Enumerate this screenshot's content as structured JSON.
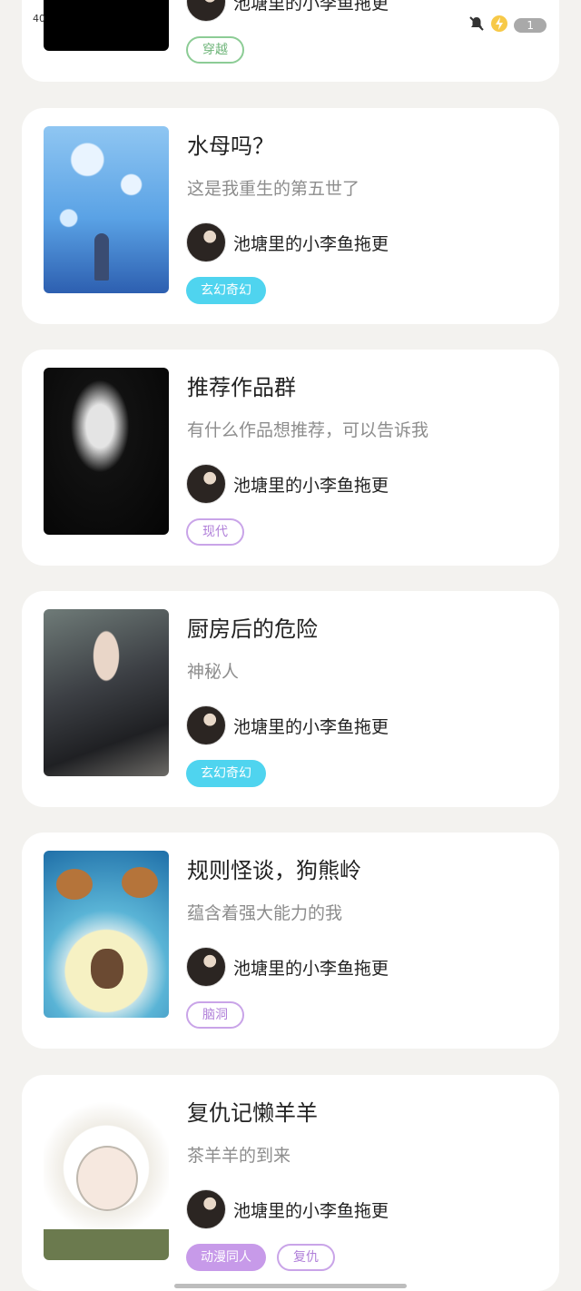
{
  "status": {
    "signal_text": "40",
    "badge_count": "1"
  },
  "works": [
    {
      "title": "",
      "desc": "",
      "author": "池塘里的小李鱼拖更",
      "tags": [
        {
          "label": "穿越"
        }
      ]
    },
    {
      "title": "水母吗？",
      "desc": "这是我重生的第五世了",
      "author": "池塘里的小李鱼拖更",
      "tags": [
        {
          "label": "玄幻奇幻"
        }
      ]
    },
    {
      "title": "推荐作品群",
      "desc": "有什么作品想推荐，可以告诉我",
      "author": "池塘里的小李鱼拖更",
      "tags": [
        {
          "label": "现代"
        }
      ]
    },
    {
      "title": "厨房后的危险",
      "desc": "神秘人",
      "author": "池塘里的小李鱼拖更",
      "tags": [
        {
          "label": "玄幻奇幻"
        }
      ]
    },
    {
      "title": "规则怪谈，狗熊岭",
      "desc": "蕴含着强大能力的我",
      "author": "池塘里的小李鱼拖更",
      "tags": [
        {
          "label": "脑洞"
        }
      ]
    },
    {
      "title": "复仇记懒羊羊",
      "desc": "茶羊羊的到来",
      "author": "池塘里的小李鱼拖更",
      "tags": [
        {
          "label": "动漫同人"
        },
        {
          "label": "复仇"
        }
      ]
    }
  ],
  "colors": {
    "background": "#f3f2ef",
    "tag_green": "#8ccc95",
    "tag_cyan": "#4fd4ef",
    "tag_purple": "#c79ae9"
  },
  "icons": [
    "bell-off-icon",
    "lightning-icon"
  ]
}
